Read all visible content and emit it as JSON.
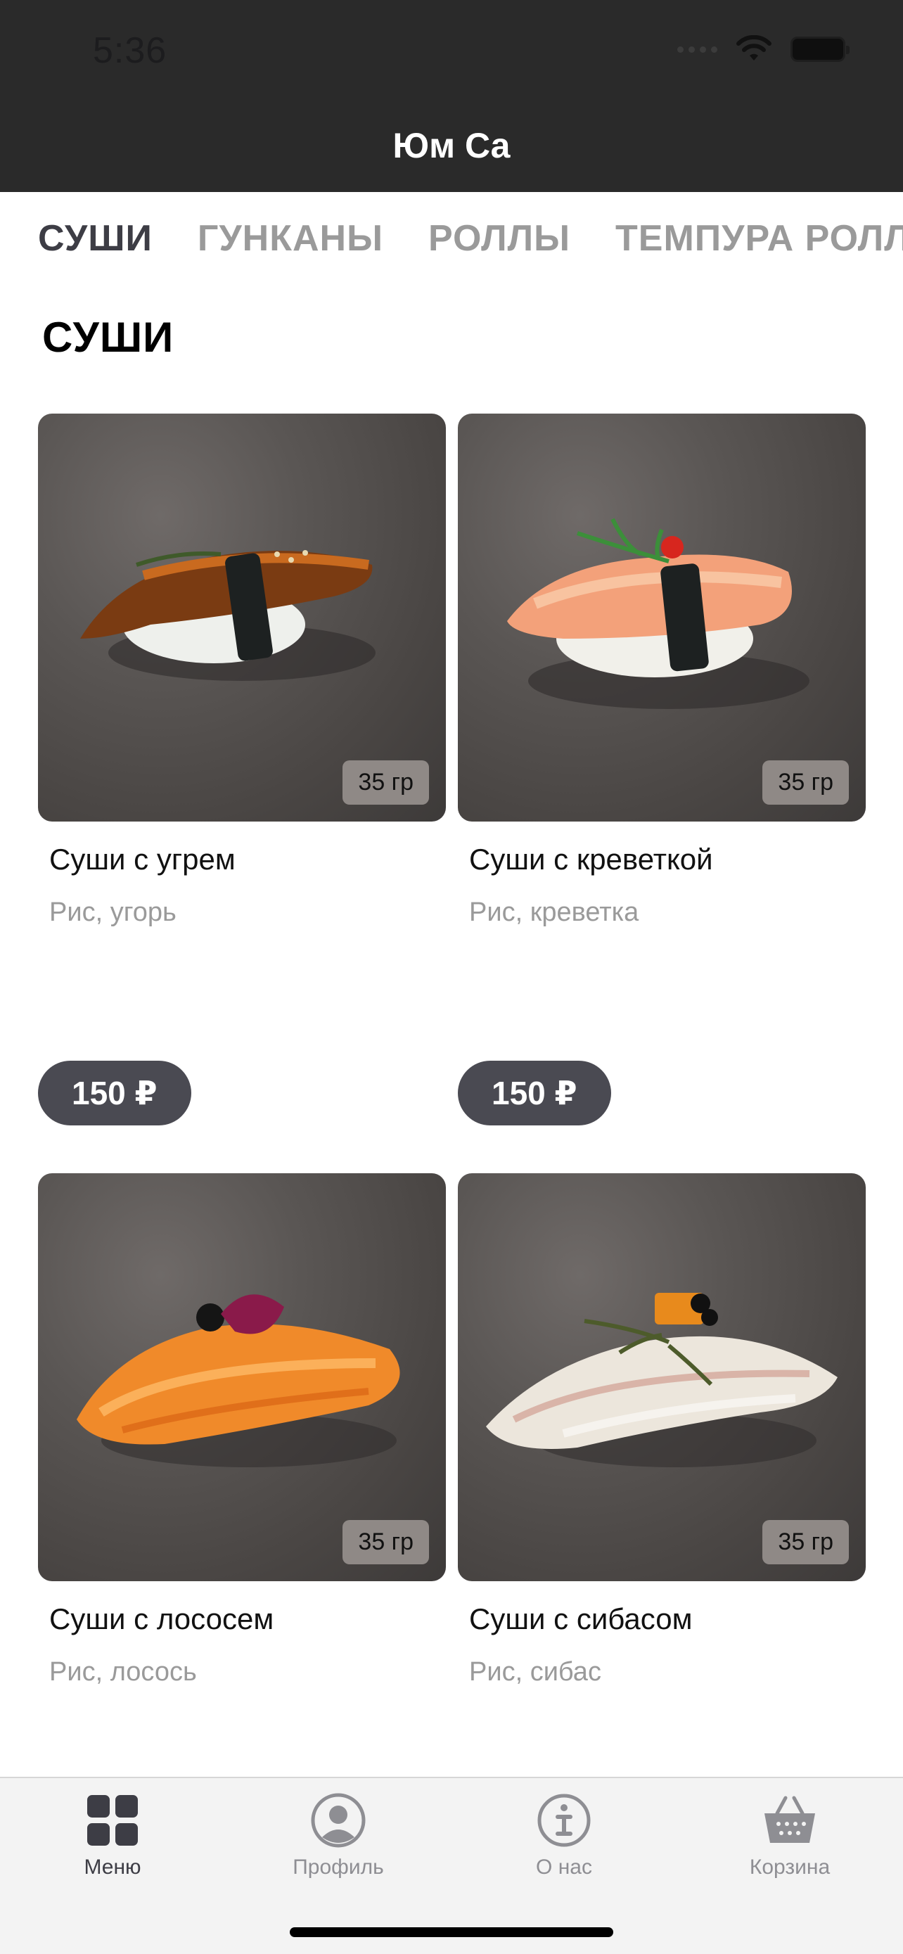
{
  "status_bar": {
    "time": "5:36"
  },
  "header": {
    "title": "Юм Са"
  },
  "categories": [
    {
      "label": "СУШИ",
      "active": true
    },
    {
      "label": "ГУНКАНЫ",
      "active": false
    },
    {
      "label": "РОЛЛЫ",
      "active": false
    },
    {
      "label": "ТЕМПУРА РОЛЛЫ",
      "active": false
    }
  ],
  "section": {
    "title": "СУШИ"
  },
  "products": [
    {
      "name": "Суши с угрем",
      "description": "Рис, угорь",
      "weight": "35 гр",
      "price": "150 ₽"
    },
    {
      "name": "Суши с креветкой",
      "description": "Рис, креветка",
      "weight": "35 гр",
      "price": "150 ₽"
    },
    {
      "name": "Суши с лососем",
      "description": "Рис, лосось",
      "weight": "35 гр"
    },
    {
      "name": "Суши с сибасом",
      "description": "Рис, сибас",
      "weight": "35 гр"
    }
  ],
  "tabbar": [
    {
      "label": "Меню",
      "icon": "grid-icon",
      "active": true
    },
    {
      "label": "Профиль",
      "icon": "profile-icon",
      "active": false
    },
    {
      "label": "О нас",
      "icon": "info-icon",
      "active": false
    },
    {
      "label": "Корзина",
      "icon": "basket-icon",
      "active": false
    }
  ],
  "colors": {
    "header_bg": "#2a2a2a",
    "price_bg": "#4a4a52",
    "active_tab": "#3d3d45",
    "inactive_tab": "#9a9a9a"
  }
}
